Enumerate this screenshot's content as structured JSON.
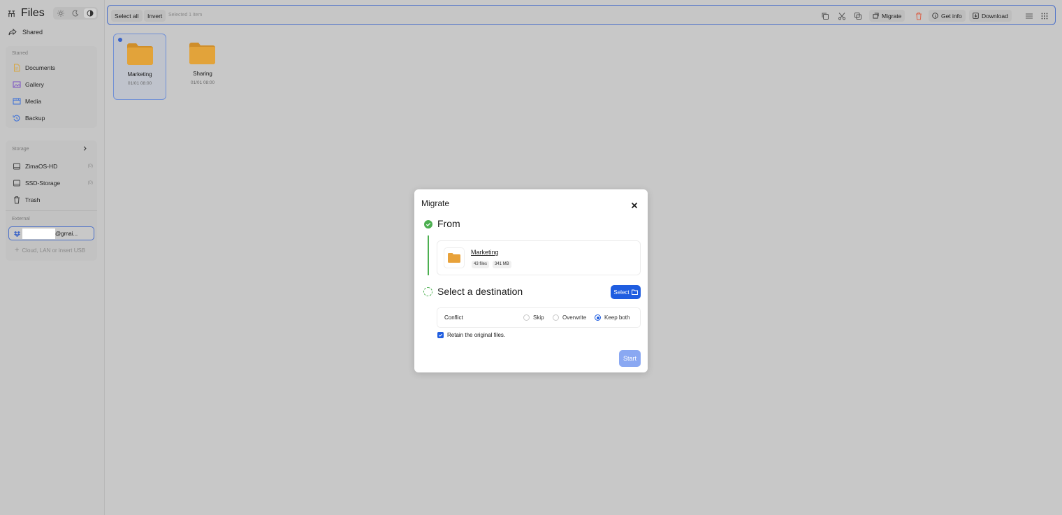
{
  "app": {
    "title": "Files"
  },
  "sidebar": {
    "shared_label": "Shared",
    "starred": {
      "heading": "Starred",
      "items": [
        {
          "label": "Documents",
          "icon": "document-icon",
          "color": "#d8a640"
        },
        {
          "label": "Gallery",
          "icon": "image-icon",
          "color": "#7a4fc4"
        },
        {
          "label": "Media",
          "icon": "media-icon",
          "color": "#3a6fd8"
        },
        {
          "label": "Backup",
          "icon": "backup-icon",
          "color": "#3a6fd8"
        }
      ]
    },
    "storage": {
      "heading": "Storage",
      "items": [
        {
          "label": "ZimaOS-HD",
          "badge": "(0)"
        },
        {
          "label": "SSD-Storage",
          "badge": "(0)"
        },
        {
          "label": "Trash",
          "badge": ""
        }
      ]
    },
    "external": {
      "heading": "External",
      "account_suffix": "@gmai...",
      "add_label": "Cloud, LAN or insert USB"
    }
  },
  "toolbar": {
    "select_all": "Select all",
    "invert": "Invert",
    "selection_status": "Selected 1 item",
    "migrate": "Migrate",
    "get_info": "Get info",
    "download": "Download"
  },
  "files": [
    {
      "name": "Marketing",
      "date": "01/01 08:00",
      "selected": true
    },
    {
      "name": "Sharing",
      "date": "01/01 08:00",
      "selected": false
    }
  ],
  "dialog": {
    "title": "Migrate",
    "from_heading": "From",
    "source": {
      "name": "Marketing",
      "files": "43 files",
      "size": "341 MB"
    },
    "destination_heading": "Select a destination",
    "select_button": "Select",
    "conflict": {
      "label": "Conflict",
      "options": [
        "Skip",
        "Overwrite",
        "Keep both"
      ],
      "selected": "Keep both"
    },
    "retain_label": "Retain the original files.",
    "retain_checked": true,
    "start_button": "Start"
  },
  "colors": {
    "accent": "#1f5de0",
    "success": "#4caf50",
    "folder": "#e9a53a"
  }
}
